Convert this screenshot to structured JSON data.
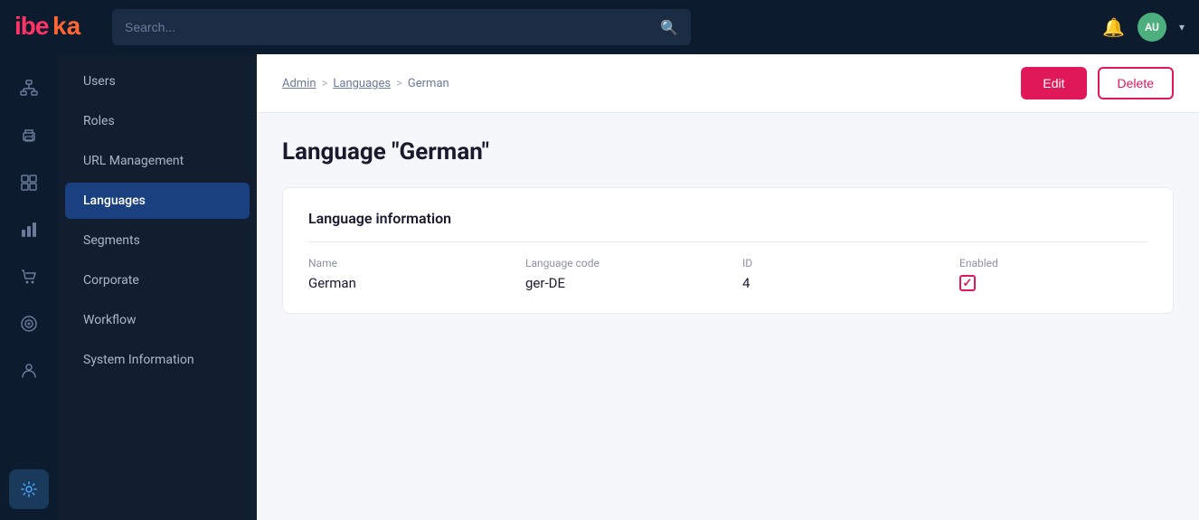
{
  "header": {
    "logo_alt": "ibeka",
    "search_placeholder": "Search...",
    "avatar_initials": "AU",
    "avatar_bg": "#4caf7d"
  },
  "icon_sidebar": {
    "items": [
      {
        "name": "org-chart-icon",
        "glyph": "⊞",
        "active": false
      },
      {
        "name": "printer-icon",
        "glyph": "🖨",
        "active": false
      },
      {
        "name": "grid-icon",
        "glyph": "⊡",
        "active": false
      },
      {
        "name": "chart-icon",
        "glyph": "📊",
        "active": false
      },
      {
        "name": "cart-icon",
        "glyph": "🛒",
        "active": false
      },
      {
        "name": "target-icon",
        "glyph": "◎",
        "active": false
      },
      {
        "name": "person-icon",
        "glyph": "👤",
        "active": false
      }
    ],
    "bottom_item": {
      "name": "settings-icon",
      "glyph": "⚙"
    }
  },
  "nav_sidebar": {
    "items": [
      {
        "label": "Users",
        "active": false
      },
      {
        "label": "Roles",
        "active": false
      },
      {
        "label": "URL Management",
        "active": false
      },
      {
        "label": "Languages",
        "active": true
      },
      {
        "label": "Segments",
        "active": false
      },
      {
        "label": "Corporate",
        "active": false
      },
      {
        "label": "Workflow",
        "active": false
      },
      {
        "label": "System Information",
        "active": false
      }
    ]
  },
  "breadcrumb": {
    "admin": "Admin",
    "sep1": ">",
    "languages": "Languages",
    "sep2": ">",
    "current": "German"
  },
  "actions": {
    "edit_label": "Edit",
    "delete_label": "Delete"
  },
  "page": {
    "title": "Language \"German\""
  },
  "language_info": {
    "section_title": "Language information",
    "name_label": "Name",
    "name_value": "German",
    "code_label": "Language code",
    "code_value": "ger-DE",
    "id_label": "ID",
    "id_value": "4",
    "enabled_label": "Enabled",
    "enabled": true
  }
}
